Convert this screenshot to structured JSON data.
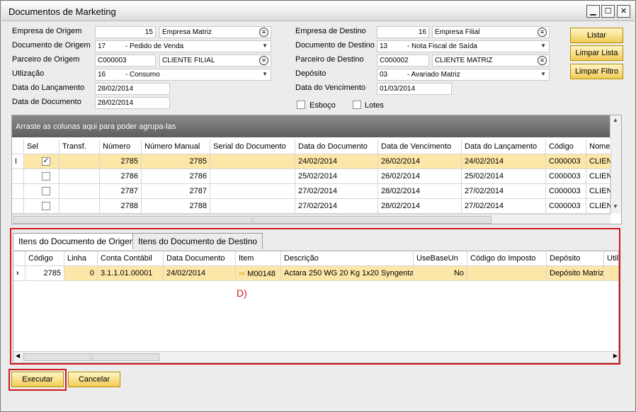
{
  "window": {
    "title": "Documentos de Marketing",
    "minimize": "▁",
    "maximize": "☐",
    "close": "✕"
  },
  "form": {
    "empresa_origem": {
      "label": "Empresa de Origem",
      "code": "15",
      "name": "Empresa Matriz"
    },
    "documento_origem": {
      "label": "Documento de Origem",
      "value": "17          - Pedido de Venda"
    },
    "parceiro_origem": {
      "label": "Parceiro de Origem",
      "code": "C000003",
      "name": "CLIENTE FILIAL"
    },
    "utilizacao": {
      "label": "Utlização",
      "value": "16          - Consumo"
    },
    "data_lancamento": {
      "label": "Data do Lançamento",
      "value": "28/02/2014"
    },
    "data_documento": {
      "label": "Data de Documento",
      "value": "28/02/2014"
    },
    "empresa_destino": {
      "label": "Empresa de Destino",
      "code": "16",
      "name": "Empresa Filial"
    },
    "documento_destino": {
      "label": "Documento de Destino",
      "value": "13          - Nota Fiscal de Saída"
    },
    "parceiro_destino": {
      "label": "Parceiro de Destino",
      "code": "C000002",
      "name": "CLIENTE MATRIZ"
    },
    "deposito": {
      "label": "Depósito",
      "value": "03          - Avariado Matriz"
    },
    "data_vencimento": {
      "label": "Data do Vencimento",
      "value": "01/03/2014"
    },
    "esboco_label": "Esboço",
    "lotes_label": "Lotes"
  },
  "buttons": {
    "listar": "Listar",
    "limpar_lista": "Limpar Lista",
    "limpar_filtro": "Limpar Filtro",
    "executar": "Executar",
    "cancelar": "Cancelar"
  },
  "grid_docs": {
    "group_hint": "Arraste as colunas aqui para poder agrupa-las",
    "columns": [
      "Sel",
      "Transf.",
      "Número",
      "Número Manual",
      "Serial do Documento",
      "Data do Documento",
      "Data de Vencimento",
      "Data do Lançamento",
      "Código",
      "Nome"
    ],
    "rows": [
      {
        "numero": "2785",
        "manual": "2785",
        "data_doc": "24/02/2014",
        "venc": "26/02/2014",
        "lanc": "24/02/2014",
        "codigo": "C000003",
        "nome": "CLIENTE F",
        "checked": true
      },
      {
        "numero": "2786",
        "manual": "2786",
        "data_doc": "25/02/2014",
        "venc": "26/02/2014",
        "lanc": "25/02/2014",
        "codigo": "C000003",
        "nome": "CLIENTE F",
        "checked": false
      },
      {
        "numero": "2787",
        "manual": "2787",
        "data_doc": "27/02/2014",
        "venc": "28/02/2014",
        "lanc": "27/02/2014",
        "codigo": "C000003",
        "nome": "CLIENTE F",
        "checked": false
      },
      {
        "numero": "2788",
        "manual": "2788",
        "data_doc": "27/02/2014",
        "venc": "28/02/2014",
        "lanc": "27/02/2014",
        "codigo": "C000003",
        "nome": "CLIENTE F",
        "checked": false
      }
    ]
  },
  "tabs": [
    "Itens do Documento de Origem",
    "Itens do Documento de Destino"
  ],
  "grid_items": {
    "columns": [
      "Código",
      "Linha",
      "Conta Contábil",
      "Data Documento",
      "Item",
      "Descrição",
      "UseBaseUn",
      "Código do Imposto",
      "Depósito",
      "Utili"
    ],
    "row": {
      "codigo": "2785",
      "linha": "0",
      "conta": "3.1.1.01.00001",
      "data": "24/02/2014",
      "item": "M00148",
      "descricao": "Actara 250 WG 20 Kg 1x20 Syngenta",
      "usebase": "No",
      "imposto": "",
      "deposito": "Depósito Matriz"
    }
  },
  "annotation": "D)",
  "colors": {
    "highlight_row": "#fde7a8",
    "button_yellow": "#f1cb56",
    "annotation_red": "#d01919"
  }
}
